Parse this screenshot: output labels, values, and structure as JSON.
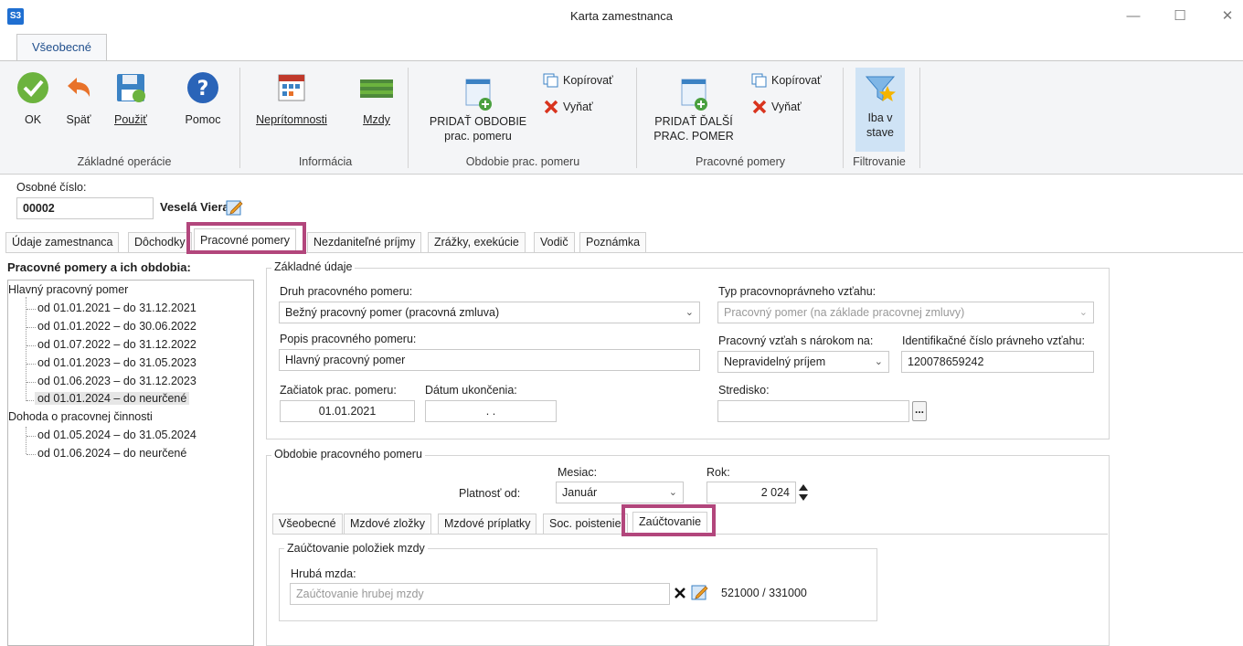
{
  "window": {
    "logo": "S3",
    "title": "Karta zamestnanca",
    "minimize_icon": "minimize-icon",
    "maximize_icon": "maximize-icon",
    "close_icon": "close-icon"
  },
  "ribbon": {
    "tab": "Všeobecné",
    "groups": {
      "basic": "Základné operácie",
      "info": "Informácia",
      "period": "Obdobie prac. pomeru",
      "relations": "Pracovné pomery",
      "filter": "Filtrovanie"
    },
    "ok": "OK",
    "back": "Späť",
    "apply": "Použiť",
    "help": "Pomoc",
    "absences": "Neprítomnosti",
    "wages": "Mzdy",
    "add_period_1": "PRIDAŤ OBDOBIE",
    "add_period_2": "prac. pomeru",
    "copy1": "Kopírovať",
    "cut1": "Vyňať",
    "add_rel_1": "PRIDAŤ ĎALŠÍ",
    "add_rel_2": "PRAC. POMER",
    "copy2": "Kopírovať",
    "cut2": "Vyňať",
    "only_state_1": "Iba v",
    "only_state_2": "stave"
  },
  "header": {
    "personal_no_label": "Osobné číslo:",
    "personal_no": "00002",
    "name": "Veselá Viera"
  },
  "main_tabs": [
    "Údaje zamestnanca",
    "Dôchodky",
    "Pracovné pomery",
    "Nezdaniteľné príjmy",
    "Zrážky, exekúcie",
    "Vodič",
    "Poznámka"
  ],
  "tree": {
    "title": "Pracovné pomery a ich obdobia:",
    "root1": "Hlavný pracovný pomer",
    "items1": [
      "od 01.01.2021 – do 31.12.2021",
      "od 01.01.2022 – do 30.06.2022",
      "od 01.07.2022 – do 31.12.2022",
      "od 01.01.2023 – do 31.05.2023",
      "od 01.06.2023 – do 31.12.2023",
      "od 01.01.2024 – do neurčené"
    ],
    "root2": "Dohoda o pracovnej činnosti",
    "items2": [
      "od 01.05.2024 – do 31.05.2024",
      "od 01.06.2024 – do neurčené"
    ]
  },
  "basic": {
    "title": "Základné údaje",
    "type_label": "Druh pracovného pomeru:",
    "type_value": "Bežný pracovný pomer (pracovná zmluva)",
    "rel_type_label": "Typ pracovnoprávneho vzťahu:",
    "rel_type_value": "Pracovný pomer (na základe pracovnej zmluvy)",
    "desc_label": "Popis pracovného pomeru:",
    "desc_value": "Hlavný pracovný pomer",
    "entitled_label": "Pracovný vzťah s nárokom na:",
    "entitled_value": "Nepravidelný príjem",
    "id_label": "Identifikačné číslo právneho vzťahu:",
    "id_value": "120078659242",
    "start_label": "Začiatok prac. pomeru:",
    "start_value": "01.01.2021",
    "end_label": "Dátum ukončenia:",
    "end_value": ".   .",
    "center_label": "Stredisko:",
    "center_value": "",
    "browse": "..."
  },
  "period": {
    "title": "Obdobie pracovného pomeru",
    "valid_from_label": "Platnosť od:",
    "month_label": "Mesiac:",
    "month_value": "Január",
    "year_label": "Rok:",
    "year_value": "2 024",
    "tabs": [
      "Všeobecné",
      "Mzdové zložky",
      "Mzdové príplatky",
      "Soc. poistenie",
      "Zaúčtovanie"
    ],
    "posting_title": "Zaúčtovanie položiek mzdy",
    "gross_label": "Hrubá mzda:",
    "gross_placeholder": "Zaúčtovanie hrubej mzdy",
    "gross_accounts": "521000 / 331000",
    "clear_icon": "clear-icon",
    "edit_icon": "edit-icon"
  },
  "colors": {
    "highlight": "#b2467c",
    "accent": "#1f4e8c"
  }
}
